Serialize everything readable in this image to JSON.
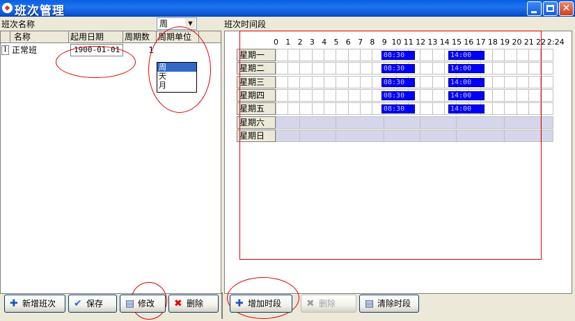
{
  "window": {
    "title": "班次管理",
    "app_icon": "◆",
    "controls": [
      "minimize-icon",
      "maximize-icon",
      "close-icon"
    ]
  },
  "left": {
    "label": "班次名称",
    "columns": [
      "名称",
      "起用日期",
      "周期数",
      "周期单位"
    ],
    "row_indicator": "I",
    "row": {
      "name": "正常班",
      "start_date": "1900-01-01",
      "cycles": "1",
      "unit": "周"
    },
    "unit_options": [
      "周",
      "天",
      "月"
    ],
    "selected_unit_index": 0
  },
  "right": {
    "label": "班次时间段",
    "hours": [
      "0",
      "1",
      "2",
      "3",
      "4",
      "5",
      "6",
      "7",
      "8",
      "9",
      "10",
      "11",
      "12",
      "13",
      "14",
      "15",
      "16",
      "17",
      "18",
      "19",
      "20",
      "21",
      "22",
      "2:24"
    ],
    "days": [
      {
        "name": "星期一",
        "weekend": false,
        "segments": [
          "08:30",
          "14:00"
        ]
      },
      {
        "name": "星期二",
        "weekend": false,
        "segments": [
          "08:30",
          "14:00"
        ]
      },
      {
        "name": "星期三",
        "weekend": false,
        "segments": [
          "08:30",
          "14:00"
        ]
      },
      {
        "name": "星期四",
        "weekend": false,
        "segments": [
          "08:30",
          "14:00"
        ]
      },
      {
        "name": "星期五",
        "weekend": false,
        "segments": [
          "08:30",
          "14:00"
        ]
      },
      {
        "name": "星期六",
        "weekend": true,
        "segments": []
      },
      {
        "name": "星期日",
        "weekend": true,
        "segments": []
      }
    ]
  },
  "left_buttons": {
    "add": "新增班次",
    "save": "保存",
    "edit": "修改",
    "delete": "删除"
  },
  "right_buttons": {
    "add_segment": "增加时段",
    "delete": "删除",
    "clear": "清除时段"
  },
  "colors": {
    "titlebar": "#0a5fe2",
    "segment": "#0000ff",
    "weekend": "#d5d5ec",
    "annotation": "#e00000"
  }
}
